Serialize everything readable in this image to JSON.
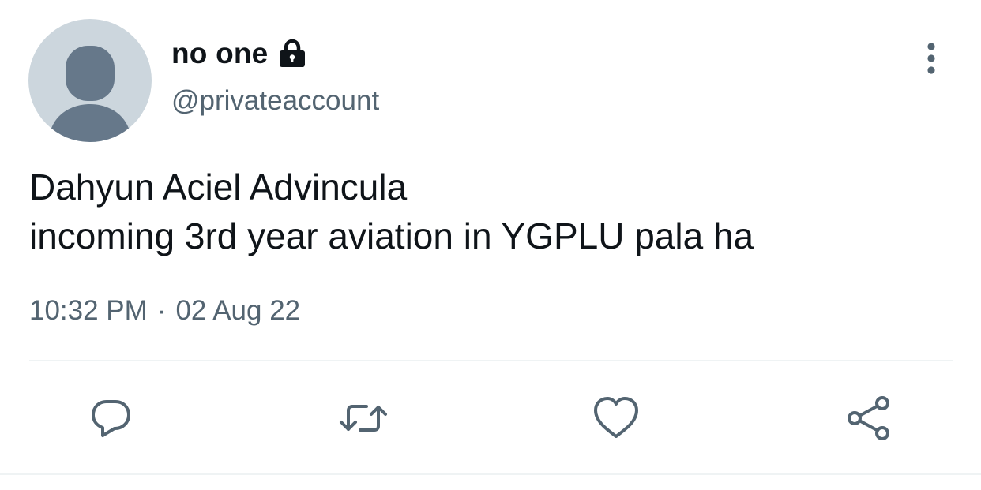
{
  "tweet": {
    "author": {
      "display_name": "no one",
      "handle": "@privateaccount",
      "protected_icon": "lock-icon"
    },
    "text_lines": [
      "Dahyun Aciel Advincula",
      "incoming 3rd year aviation in YGPLU pala ha"
    ],
    "time": "10:32 PM",
    "separator": "·",
    "date": "02 Aug 22"
  },
  "actions": [
    {
      "name": "reply",
      "icon": "comment-bubble-icon"
    },
    {
      "name": "retweet",
      "icon": "retweet-arrows-icon"
    },
    {
      "name": "like",
      "icon": "heart-icon"
    },
    {
      "name": "share",
      "icon": "share-nodes-icon"
    }
  ],
  "colors": {
    "text_primary": "#0f1419",
    "text_secondary": "#536471",
    "avatar_bg": "#ccd6dd",
    "avatar_fg": "#66788a",
    "divider": "#eff3f4"
  }
}
